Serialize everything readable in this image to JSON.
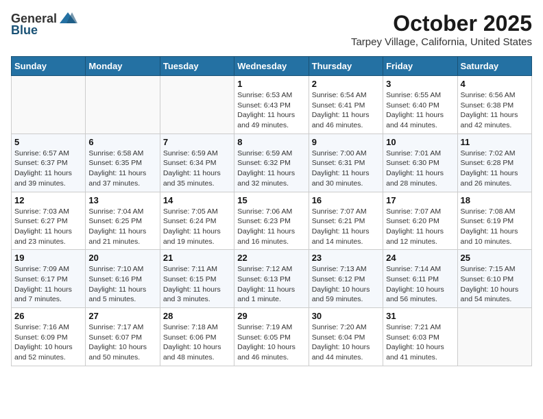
{
  "logo": {
    "general": "General",
    "blue": "Blue"
  },
  "header": {
    "month": "October 2025",
    "location": "Tarpey Village, California, United States"
  },
  "weekdays": [
    "Sunday",
    "Monday",
    "Tuesday",
    "Wednesday",
    "Thursday",
    "Friday",
    "Saturday"
  ],
  "weeks": [
    [
      {
        "day": "",
        "info": ""
      },
      {
        "day": "",
        "info": ""
      },
      {
        "day": "",
        "info": ""
      },
      {
        "day": "1",
        "info": "Sunrise: 6:53 AM\nSunset: 6:43 PM\nDaylight: 11 hours\nand 49 minutes."
      },
      {
        "day": "2",
        "info": "Sunrise: 6:54 AM\nSunset: 6:41 PM\nDaylight: 11 hours\nand 46 minutes."
      },
      {
        "day": "3",
        "info": "Sunrise: 6:55 AM\nSunset: 6:40 PM\nDaylight: 11 hours\nand 44 minutes."
      },
      {
        "day": "4",
        "info": "Sunrise: 6:56 AM\nSunset: 6:38 PM\nDaylight: 11 hours\nand 42 minutes."
      }
    ],
    [
      {
        "day": "5",
        "info": "Sunrise: 6:57 AM\nSunset: 6:37 PM\nDaylight: 11 hours\nand 39 minutes."
      },
      {
        "day": "6",
        "info": "Sunrise: 6:58 AM\nSunset: 6:35 PM\nDaylight: 11 hours\nand 37 minutes."
      },
      {
        "day": "7",
        "info": "Sunrise: 6:59 AM\nSunset: 6:34 PM\nDaylight: 11 hours\nand 35 minutes."
      },
      {
        "day": "8",
        "info": "Sunrise: 6:59 AM\nSunset: 6:32 PM\nDaylight: 11 hours\nand 32 minutes."
      },
      {
        "day": "9",
        "info": "Sunrise: 7:00 AM\nSunset: 6:31 PM\nDaylight: 11 hours\nand 30 minutes."
      },
      {
        "day": "10",
        "info": "Sunrise: 7:01 AM\nSunset: 6:30 PM\nDaylight: 11 hours\nand 28 minutes."
      },
      {
        "day": "11",
        "info": "Sunrise: 7:02 AM\nSunset: 6:28 PM\nDaylight: 11 hours\nand 26 minutes."
      }
    ],
    [
      {
        "day": "12",
        "info": "Sunrise: 7:03 AM\nSunset: 6:27 PM\nDaylight: 11 hours\nand 23 minutes."
      },
      {
        "day": "13",
        "info": "Sunrise: 7:04 AM\nSunset: 6:25 PM\nDaylight: 11 hours\nand 21 minutes."
      },
      {
        "day": "14",
        "info": "Sunrise: 7:05 AM\nSunset: 6:24 PM\nDaylight: 11 hours\nand 19 minutes."
      },
      {
        "day": "15",
        "info": "Sunrise: 7:06 AM\nSunset: 6:23 PM\nDaylight: 11 hours\nand 16 minutes."
      },
      {
        "day": "16",
        "info": "Sunrise: 7:07 AM\nSunset: 6:21 PM\nDaylight: 11 hours\nand 14 minutes."
      },
      {
        "day": "17",
        "info": "Sunrise: 7:07 AM\nSunset: 6:20 PM\nDaylight: 11 hours\nand 12 minutes."
      },
      {
        "day": "18",
        "info": "Sunrise: 7:08 AM\nSunset: 6:19 PM\nDaylight: 11 hours\nand 10 minutes."
      }
    ],
    [
      {
        "day": "19",
        "info": "Sunrise: 7:09 AM\nSunset: 6:17 PM\nDaylight: 11 hours\nand 7 minutes."
      },
      {
        "day": "20",
        "info": "Sunrise: 7:10 AM\nSunset: 6:16 PM\nDaylight: 11 hours\nand 5 minutes."
      },
      {
        "day": "21",
        "info": "Sunrise: 7:11 AM\nSunset: 6:15 PM\nDaylight: 11 hours\nand 3 minutes."
      },
      {
        "day": "22",
        "info": "Sunrise: 7:12 AM\nSunset: 6:13 PM\nDaylight: 11 hours\nand 1 minute."
      },
      {
        "day": "23",
        "info": "Sunrise: 7:13 AM\nSunset: 6:12 PM\nDaylight: 10 hours\nand 59 minutes."
      },
      {
        "day": "24",
        "info": "Sunrise: 7:14 AM\nSunset: 6:11 PM\nDaylight: 10 hours\nand 56 minutes."
      },
      {
        "day": "25",
        "info": "Sunrise: 7:15 AM\nSunset: 6:10 PM\nDaylight: 10 hours\nand 54 minutes."
      }
    ],
    [
      {
        "day": "26",
        "info": "Sunrise: 7:16 AM\nSunset: 6:09 PM\nDaylight: 10 hours\nand 52 minutes."
      },
      {
        "day": "27",
        "info": "Sunrise: 7:17 AM\nSunset: 6:07 PM\nDaylight: 10 hours\nand 50 minutes."
      },
      {
        "day": "28",
        "info": "Sunrise: 7:18 AM\nSunset: 6:06 PM\nDaylight: 10 hours\nand 48 minutes."
      },
      {
        "day": "29",
        "info": "Sunrise: 7:19 AM\nSunset: 6:05 PM\nDaylight: 10 hours\nand 46 minutes."
      },
      {
        "day": "30",
        "info": "Sunrise: 7:20 AM\nSunset: 6:04 PM\nDaylight: 10 hours\nand 44 minutes."
      },
      {
        "day": "31",
        "info": "Sunrise: 7:21 AM\nSunset: 6:03 PM\nDaylight: 10 hours\nand 41 minutes."
      },
      {
        "day": "",
        "info": ""
      }
    ]
  ]
}
